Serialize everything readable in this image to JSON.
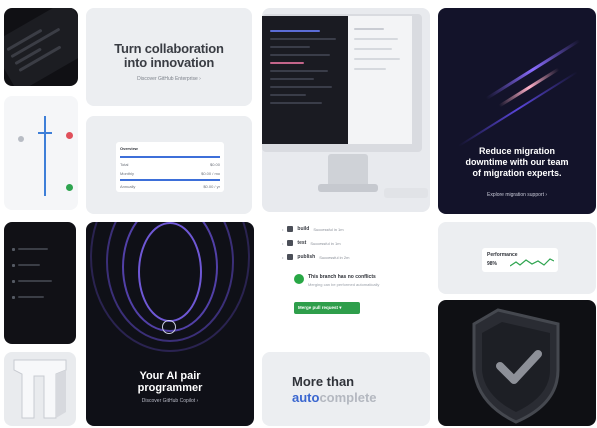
{
  "collaboration": {
    "title_line1": "Turn collaboration",
    "title_line2": "into innovation",
    "link": "Discover GitHub Enterprise ›"
  },
  "migration": {
    "title_line1": "Reduce migration",
    "title_line2": "downtime with our team",
    "title_line3": "of migration experts.",
    "link": "Explore migration support ›"
  },
  "ai": {
    "title_line1": "Your AI pair",
    "title_line2": "programmer",
    "link": "Discover GitHub Copilot ›"
  },
  "checks": {
    "rows": [
      {
        "name": "build",
        "detail": "Successful in 1m"
      },
      {
        "name": "test",
        "detail": "Successful in 1m"
      },
      {
        "name": "publish",
        "detail": "Successful in 2m"
      }
    ],
    "status_title": "This branch has no conflicts",
    "status_sub": "Merging can be performed automatically",
    "merge_button": "Merge pull request ▾"
  },
  "performance": {
    "label": "Performance",
    "value": "98%"
  },
  "autocomplete": {
    "line1": "More than",
    "typed": "auto",
    "ghost": "complete"
  },
  "table": {
    "header": "Overview",
    "rows": [
      {
        "name": "Total",
        "value": "$0.00"
      },
      {
        "name": "Monthly",
        "value": "$0.00 / mo"
      },
      {
        "name": "Annually",
        "value": "$0.00 / yr"
      }
    ]
  },
  "colors": {
    "accent_blue": "#3d6fd9",
    "success_green": "#2e9e4b",
    "beam_purple": "#6c4dff",
    "beam_pink": "#ff9ab8",
    "dark_bg": "#13132a"
  }
}
